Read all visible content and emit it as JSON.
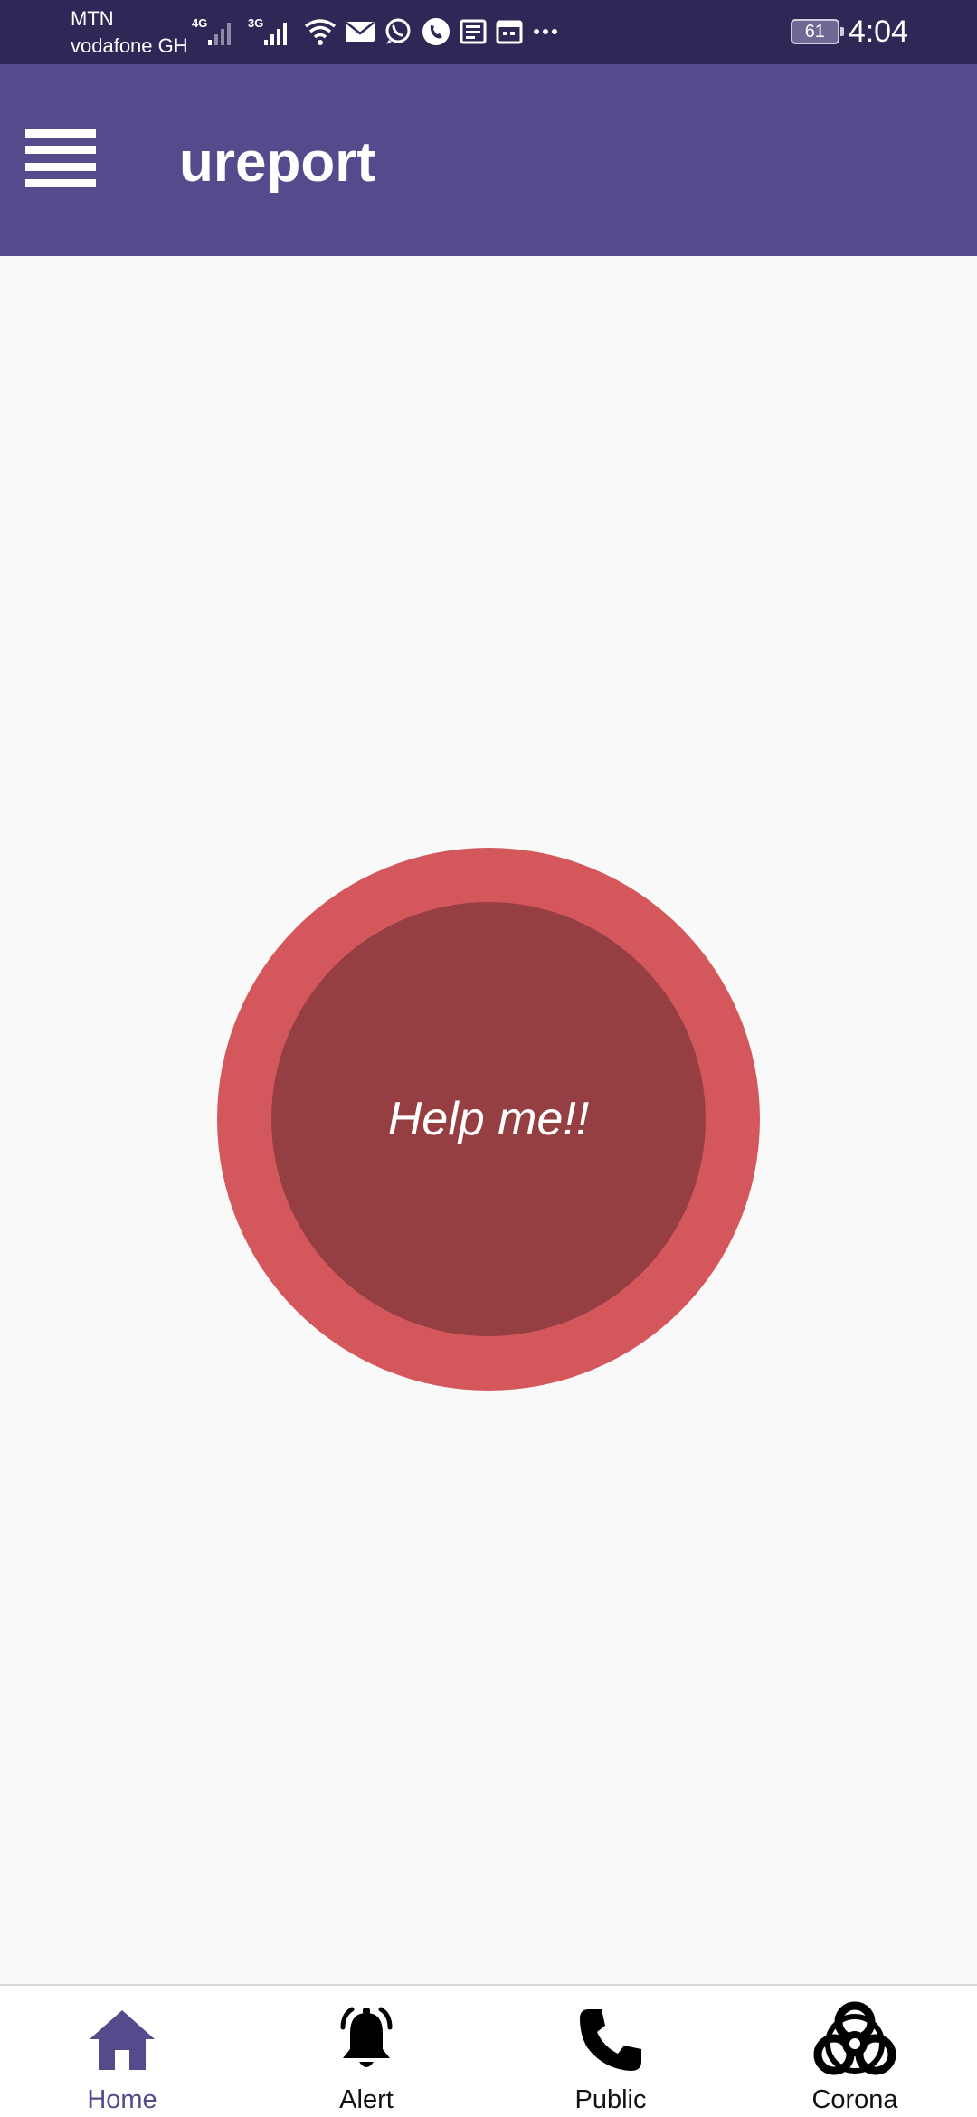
{
  "status_bar": {
    "carrier_1": "MTN",
    "carrier_2": "vodafone GH",
    "network_1": "4G",
    "network_2": "3G",
    "battery": "61",
    "time": "4:04",
    "icons": [
      "signal-4g-icon",
      "signal-3g-icon",
      "wifi-icon",
      "mail-icon",
      "whatsapp-icon",
      "phone-icon",
      "news-icon",
      "calendar-icon",
      "more-icon"
    ]
  },
  "app_bar": {
    "title": "ureport",
    "menu_icon": "hamburger-menu-icon"
  },
  "main": {
    "help_button_label": "Help me!!"
  },
  "bottom_nav": {
    "items": [
      {
        "label": "Home",
        "icon": "home-icon",
        "active": true
      },
      {
        "label": "Alert",
        "icon": "bell-icon",
        "active": false
      },
      {
        "label": "Public",
        "icon": "phone-icon",
        "active": false
      },
      {
        "label": "Corona",
        "icon": "biohazard-icon",
        "active": false
      }
    ]
  },
  "colors": {
    "status_bar_bg": "#2e2857",
    "app_bar_bg": "#554a8c",
    "help_outer": "#d4585b",
    "help_inner": "#953f42",
    "active_nav": "#554a8c",
    "background": "#f9f9f9"
  }
}
